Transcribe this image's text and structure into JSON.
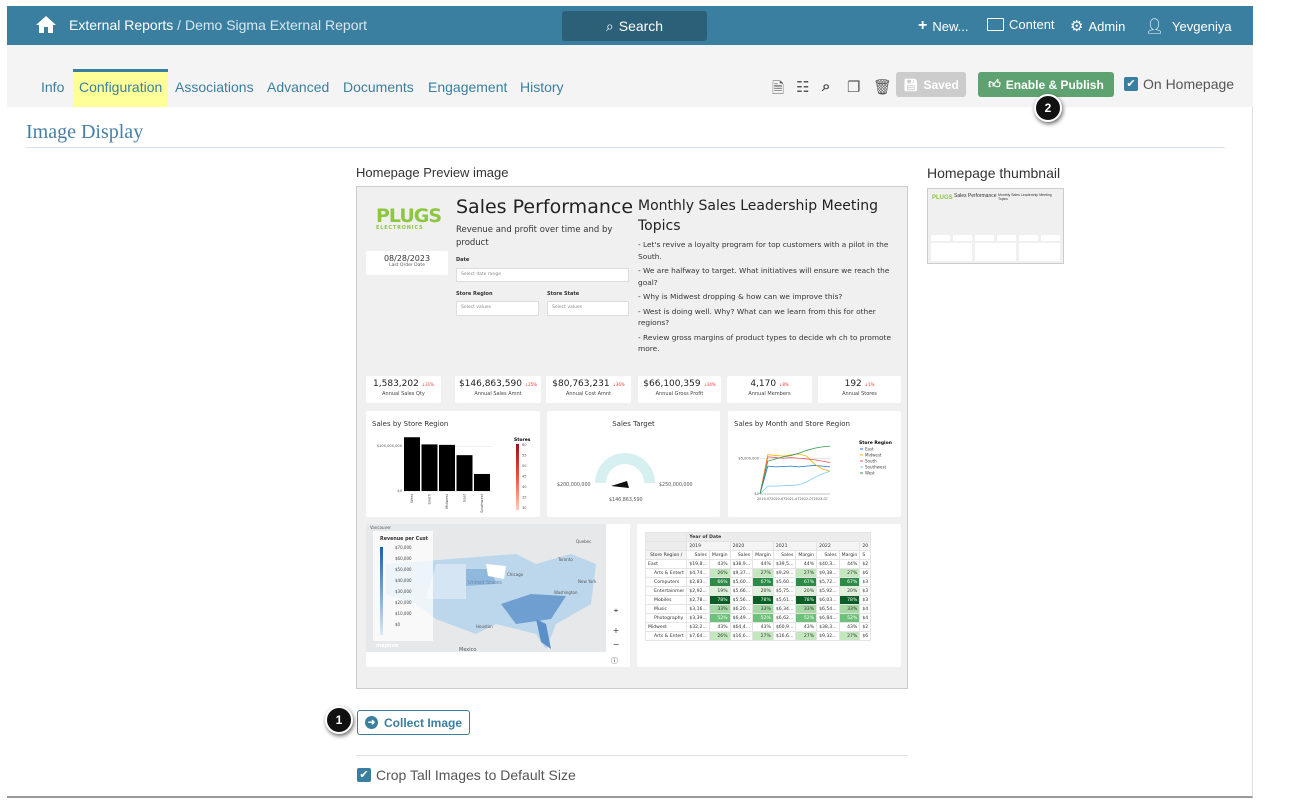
{
  "header": {
    "crumb_root": "External Reports",
    "crumb_sep": " / ",
    "crumb_page": "Demo Sigma External Report",
    "search_label": "Search",
    "new_label": "New...",
    "content_label": "Content",
    "admin_label": "Admin",
    "user_label": "Yevgeniya"
  },
  "tabs": [
    {
      "label": "Info"
    },
    {
      "label": "Configuration",
      "active": true
    },
    {
      "label": "Associations"
    },
    {
      "label": "Advanced"
    },
    {
      "label": "Documents"
    },
    {
      "label": "Engagement"
    },
    {
      "label": "History"
    }
  ],
  "toolbar": {
    "saved_label": "Saved",
    "publish_label": "Enable & Publish",
    "on_homepage_label": "On Homepage",
    "on_homepage_checked": true
  },
  "section": {
    "title": "Image Display",
    "preview_label": "Homepage Preview image",
    "thumbnail_label": "Homepage thumbnail",
    "collect_label": "Collect Image",
    "crop_label": "Crop Tall Images to Default Size",
    "crop_checked": true
  },
  "badges": {
    "one": "1",
    "two": "2"
  },
  "colors": {
    "header": "#3a7fa0",
    "publish": "#5fa271",
    "highlight": "#ffff99",
    "logo": "#8dc63f"
  },
  "dashboard": {
    "logo_top": "PLUGS",
    "logo_bottom": "ELECTRONICS",
    "date_value": "08/28/2023",
    "date_label": "Last Order Date",
    "title": "Sales Performance",
    "subtitle": "Revenue and profit over time and by product",
    "date_filter_label": "Date",
    "date_placeholder": "Select date range",
    "region_label": "Store Region",
    "state_label": "Store State",
    "select_placeholder": "Select values",
    "topics_title": "Monthly Sales Leadership Meeting Topics",
    "topics": [
      "- Let's revive a loyalty program for top customers with a pilot in the South.",
      "- We are halfway to target. What initiatives will ensure we reach the goal?",
      "- Why is Midwest dropping & how can we improve this?",
      "- West is doing well. Why? What can we learn from this for other regions?",
      "- Review gross margins of product types to decide wh ch to promote more."
    ],
    "kpis": [
      {
        "value": "1,583,202",
        "delta": "↓31%",
        "label": "Annual Sales Qty"
      },
      {
        "value": "$146,863,590",
        "delta": "↓25%",
        "label": "Annual Sales Amnt"
      },
      {
        "value": "$80,763,231",
        "delta": "↓36%",
        "label": "Annual Cost Amnt"
      },
      {
        "value": "$66,100,359",
        "delta": "↓34%",
        "label": "Annual Gross Profit"
      },
      {
        "value": "4,170",
        "delta": "↓8%",
        "label": "Annual Members"
      },
      {
        "value": "192",
        "delta": "↓1%",
        "label": "Annual Stores"
      }
    ],
    "gauge": {
      "title": "Sales Target",
      "min_label": "$200,000,000",
      "max_label": "$250,000,000",
      "value_label": "$146,863,590"
    },
    "map": {
      "legend_title": "Revenue per Cust",
      "legend": [
        "$70,000",
        "$60,000",
        "$50,000",
        "$40,000",
        "$30,000",
        "$20,000",
        "$10,000",
        "$0"
      ],
      "labels": {
        "vancouver": "Vancouver",
        "quebec": "Quebec",
        "toronto": "Toronto",
        "chicago": "Chicago",
        "us": "United States",
        "newyork": "New York",
        "washington": "Washington",
        "houston": "Houston",
        "mexico": "Mexico",
        "attribution": "mapbox"
      }
    },
    "table": {
      "header_label": "Year of Date",
      "years": [
        "2019",
        "2020",
        "2021",
        "2022",
        "20"
      ],
      "row_header": "Store Region /",
      "sub": [
        "Sales",
        "Margin"
      ],
      "rows": [
        {
          "name": "East",
          "group": true,
          "cells": [
            "$19,8...",
            "43%",
            "$38,9...",
            "44%",
            "$39,5...",
            "44%",
            "$40,3...",
            "44%",
            "$2"
          ]
        },
        {
          "name": "Arts & Entert",
          "cells": [
            "$4,74...",
            "26%",
            "$9,37...",
            "27%",
            "$9,29...",
            "27%",
            "$9,38...",
            "27%",
            "$6"
          ]
        },
        {
          "name": "Computers",
          "cells": [
            "$2,83...",
            "66%",
            "$5,60...",
            "67%",
            "$5,60...",
            "67%",
            "$5,72...",
            "67%",
            "$3"
          ]
        },
        {
          "name": "Entertainmer",
          "cells": [
            "$2,92...",
            "19%",
            "$5,66...",
            "20%",
            "$5,75...",
            "20%",
            "$5,92...",
            "20%",
            "$3"
          ]
        },
        {
          "name": "Mobiles",
          "cells": [
            "$2,78...",
            "78%",
            "$5,56...",
            "78%",
            "$5,61...",
            "78%",
            "$6,03...",
            "78%",
            "$3"
          ]
        },
        {
          "name": "Music",
          "cells": [
            "$3,16...",
            "33%",
            "$6,20...",
            "33%",
            "$6,34...",
            "33%",
            "$6,54...",
            "33%",
            "$4"
          ]
        },
        {
          "name": "Photography",
          "cells": [
            "$3,39...",
            "52%",
            "$6,49...",
            "52%",
            "$6,62...",
            "52%",
            "$6,84...",
            "52%",
            "$4"
          ]
        },
        {
          "name": "Midwest",
          "group": true,
          "cells": [
            "$32,2...",
            "43%",
            "$64,4...",
            "43%",
            "$60,9...",
            "43%",
            "$38,3...",
            "43%",
            "$2"
          ]
        },
        {
          "name": "Arts & Entert",
          "cells": [
            "$7,64...",
            "26%",
            "$16,6...",
            "27%",
            "$16,6...",
            "27%",
            "$9,32...",
            "27%",
            "$6"
          ]
        }
      ]
    }
  },
  "chart_data": [
    {
      "type": "bar",
      "title": "Sales by Store Region",
      "categories": [
        "West",
        "South",
        "Midwest",
        "East",
        "Southwest"
      ],
      "values": [
        120000000,
        104000000,
        103000000,
        80000000,
        38000000
      ],
      "stores": [
        60,
        35,
        50,
        25,
        40
      ],
      "ytick_labels": [
        "$100,000,000",
        "$0"
      ],
      "legend_title": "Stores",
      "legend_ticks": [
        "60",
        "55",
        "50",
        "45",
        "40",
        "35",
        "30"
      ],
      "ylim": [
        0,
        125000000
      ]
    },
    {
      "type": "line",
      "title": "Sales by Month and Store Region",
      "legend_title": "Store Region",
      "ytick_labels": [
        "$5,000,000",
        "$0"
      ],
      "xtick_label": "2019-072020-072021-072022-072023-07",
      "ylim": [
        0,
        7000000
      ],
      "series": [
        {
          "name": "East",
          "color": "#1f77d4",
          "values": [
            0,
            3900000,
            3800000,
            3850000,
            3900000,
            3800000,
            3900000,
            4000000,
            3900000,
            3800000
          ]
        },
        {
          "name": "Midwest",
          "color": "#f2b600",
          "values": [
            0,
            5500000,
            5400000,
            5300000,
            5500000,
            5600000,
            5300000,
            4200000,
            3500000,
            3200000
          ]
        },
        {
          "name": "South",
          "color": "#f0595c",
          "values": [
            0,
            5200000,
            5100000,
            5000000,
            5100000,
            5000000,
            4900000,
            4800000,
            4600000,
            4400000
          ]
        },
        {
          "name": "Southwest",
          "color": "#7cc8f5",
          "values": [
            0,
            1100000,
            1100000,
            1150000,
            1200000,
            1300000,
            1700000,
            2300000,
            2800000,
            3200000
          ]
        },
        {
          "name": "West",
          "color": "#2e9a4e",
          "values": [
            0,
            4600000,
            4900000,
            5200000,
            5400000,
            5700000,
            6100000,
            6400000,
            6600000,
            6700000
          ]
        }
      ]
    }
  ]
}
